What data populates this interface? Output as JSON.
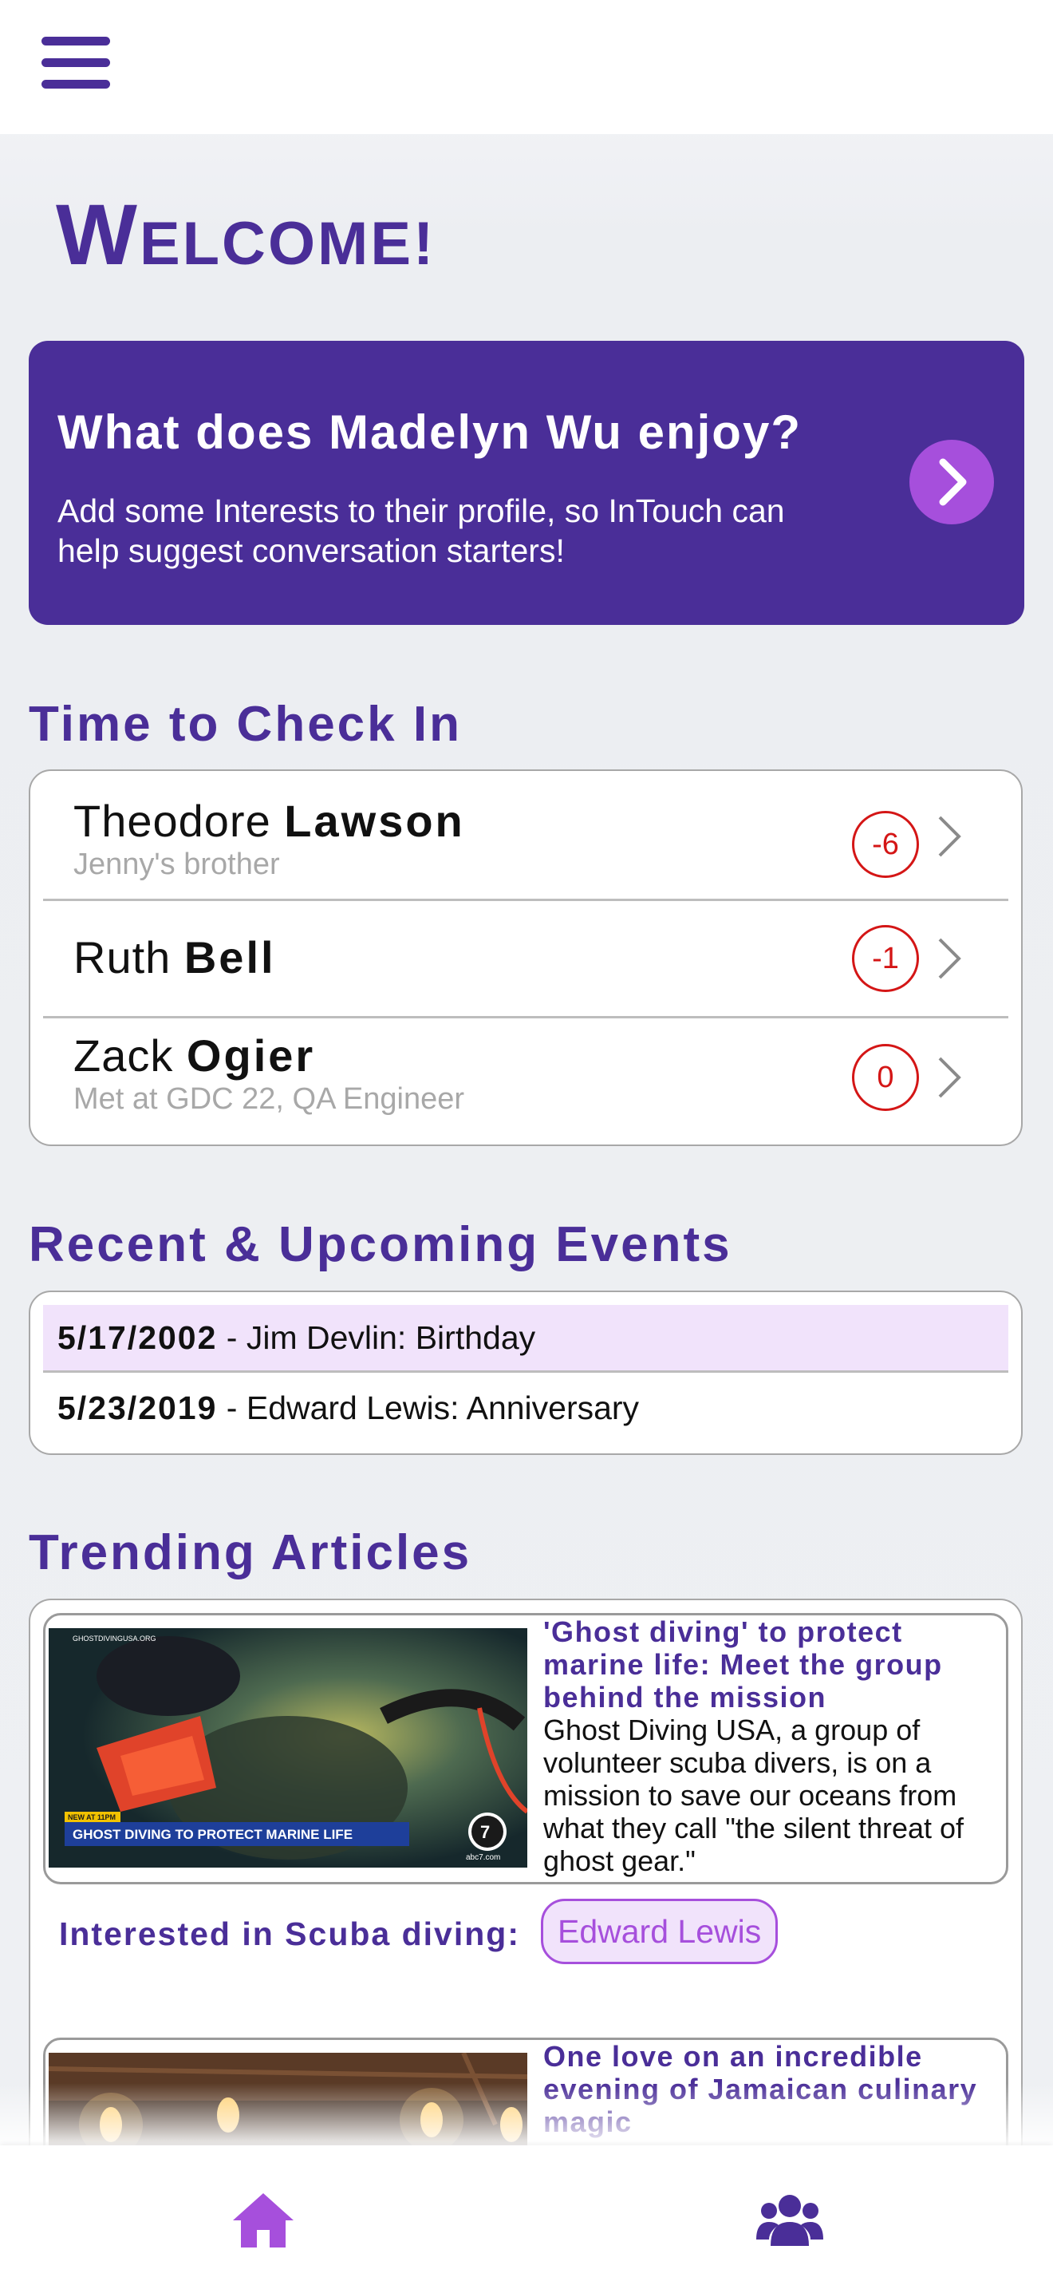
{
  "header": {
    "menu_icon": "hamburger-menu-icon"
  },
  "welcome": {
    "first": "W",
    "rest": "ELCOME!"
  },
  "promo": {
    "title": "What does Madelyn Wu enjoy?",
    "body": "Add some Interests to their profile, so InTouch can help suggest conversation starters!",
    "arrow_icon": "chevron-right-circle-icon"
  },
  "check_in": {
    "title": "Time to Check In",
    "contacts": [
      {
        "first": "Theodore ",
        "last": "Lawson",
        "note": "Jenny's brother",
        "score": "-6"
      },
      {
        "first": "Ruth ",
        "last": "Bell",
        "note": "",
        "score": "-1"
      },
      {
        "first": "Zack ",
        "last": "Ogier",
        "note": "Met at GDC 22, QA Engineer",
        "score": "0"
      }
    ]
  },
  "events": {
    "title": "Recent & Upcoming Events",
    "items": [
      {
        "date": "5/17/2002",
        "text": " - Jim Devlin: Birthday",
        "highlighted": true
      },
      {
        "date": "5/23/2019",
        "text": " - Edward Lewis: Anniversary",
        "highlighted": false
      }
    ]
  },
  "articles": {
    "title": "Trending Articles",
    "items": [
      {
        "title": "'Ghost diving' to protect marine life: Meet the group behind the mission",
        "body": "Ghost Diving USA, a group of volunteer scuba divers, is on a mission to save our oceans from what they call \"the silent threat of ghost gear.\"",
        "thumb_caption_top": "NEW AT 11PM",
        "thumb_caption": "GHOST DIVING TO PROTECT MARINE LIFE",
        "thumb_site": "GHOSTDIVINGUSA.ORG",
        "thumb_logo": "abc7.com",
        "interest_label": "Interested in Scuba diving:",
        "interest_person": "Edward Lewis"
      },
      {
        "title": "One love on an incredible evening of Jamaican culinary magic",
        "body": ""
      }
    ]
  },
  "bottom_nav": {
    "home_icon": "home-icon",
    "people_icon": "people-icon"
  },
  "colors": {
    "primary": "#4a2e98",
    "accent": "#a64fdc",
    "alert": "#d41616",
    "highlight": "#f1e3fb"
  }
}
